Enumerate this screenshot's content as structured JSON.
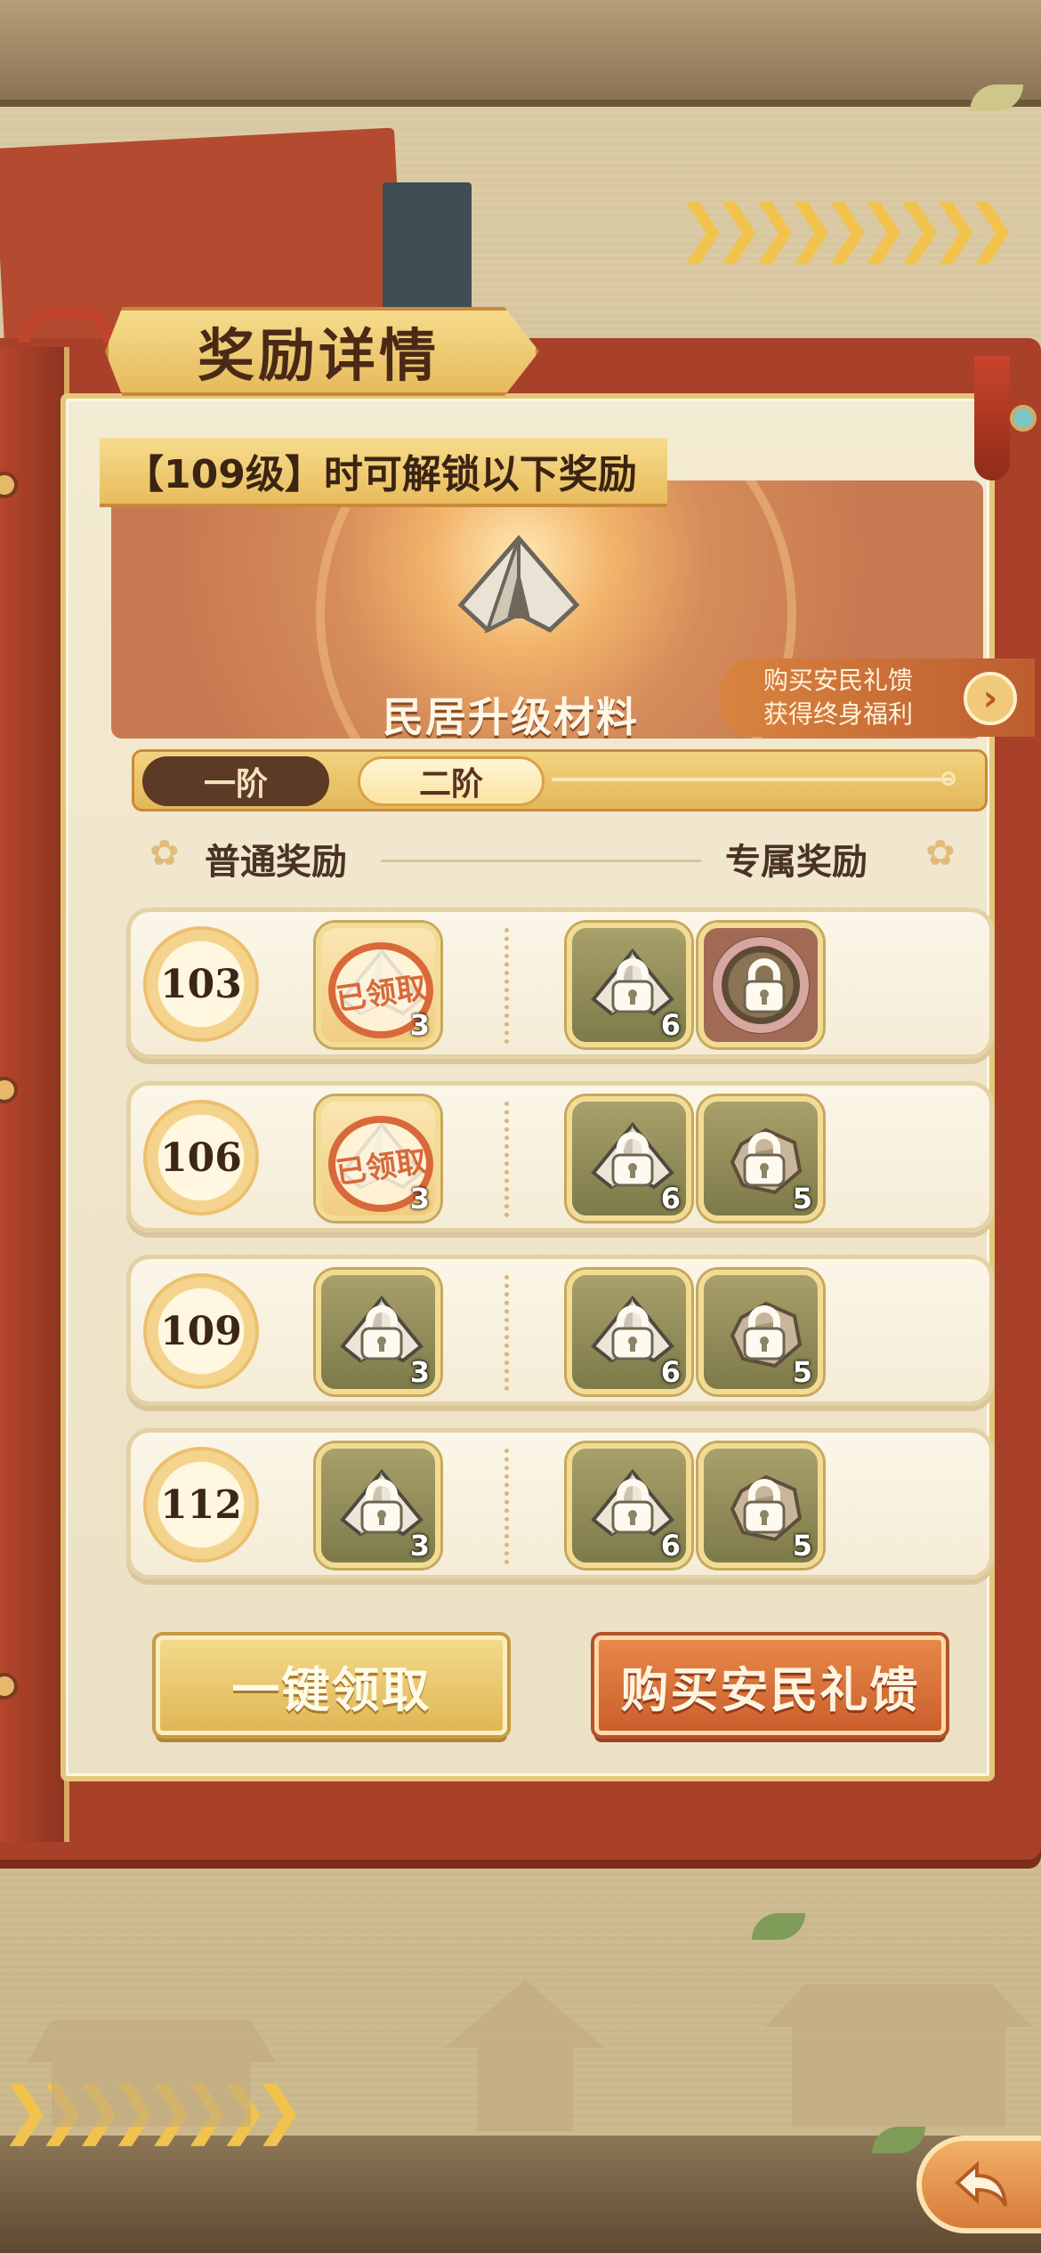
{
  "title": "奖励详情",
  "banner": {
    "unlock_text": "【109级】时可解锁以下奖励",
    "item_name": "民居升级材料",
    "promo_line1": "购买安民礼馈",
    "promo_line2": "获得终身福利",
    "promo_arrow": "›"
  },
  "tiers": [
    {
      "label": "一阶",
      "active": false
    },
    {
      "label": "二阶",
      "active": true
    }
  ],
  "headers": {
    "normal": "普通奖励",
    "exclusive": "专属奖励"
  },
  "rows": [
    {
      "level": "103",
      "normal": {
        "icon": "tent-icon",
        "qty": "3",
        "claimed": true,
        "claimed_text": "已领取"
      },
      "exclusive": [
        {
          "icon": "tent-icon",
          "qty": "6",
          "locked": true
        },
        {
          "icon": "avatar-frame-icon",
          "qty": "",
          "locked": true
        }
      ]
    },
    {
      "level": "106",
      "normal": {
        "icon": "tent-icon",
        "qty": "3",
        "claimed": true,
        "claimed_text": "已领取"
      },
      "exclusive": [
        {
          "icon": "tent-icon",
          "qty": "6",
          "locked": true
        },
        {
          "icon": "stone-icon",
          "qty": "5",
          "locked": true
        }
      ]
    },
    {
      "level": "109",
      "normal": {
        "icon": "tent-icon",
        "qty": "3",
        "claimed": false,
        "locked": true
      },
      "exclusive": [
        {
          "icon": "tent-icon",
          "qty": "6",
          "locked": true
        },
        {
          "icon": "stone-icon",
          "qty": "5",
          "locked": true
        }
      ]
    },
    {
      "level": "112",
      "normal": {
        "icon": "tent-icon",
        "qty": "3",
        "claimed": false,
        "locked": true
      },
      "exclusive": [
        {
          "icon": "tent-icon",
          "qty": "6",
          "locked": true
        },
        {
          "icon": "stone-icon",
          "qty": "5",
          "locked": true
        }
      ]
    }
  ],
  "buttons": {
    "claim_all": "一键领取",
    "buy_gift": "购买安民礼馈"
  },
  "colors": {
    "accent_gold": "#e6ba5c",
    "accent_red": "#a8402a",
    "button_orange": "#cc5f2d",
    "stamp_orange": "#d8693a"
  }
}
